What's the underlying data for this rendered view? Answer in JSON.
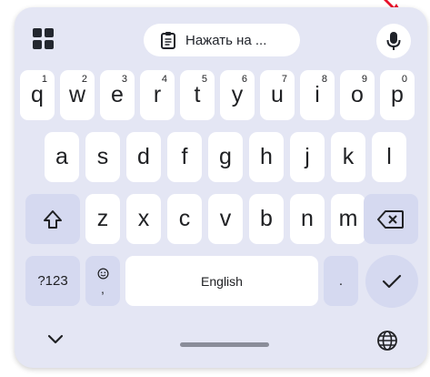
{
  "toolbar": {
    "grid_icon": "grid-apps-icon",
    "clipboard_icon": "clipboard-icon",
    "clipboard_text": "Нажать на ...",
    "mic_icon": "microphone-icon"
  },
  "rows": {
    "row1": [
      {
        "label": "q",
        "hint": "1"
      },
      {
        "label": "w",
        "hint": "2"
      },
      {
        "label": "e",
        "hint": "3"
      },
      {
        "label": "r",
        "hint": "4"
      },
      {
        "label": "t",
        "hint": "5"
      },
      {
        "label": "y",
        "hint": "6"
      },
      {
        "label": "u",
        "hint": "7"
      },
      {
        "label": "i",
        "hint": "8"
      },
      {
        "label": "o",
        "hint": "9"
      },
      {
        "label": "p",
        "hint": "0"
      }
    ],
    "row2": [
      "a",
      "s",
      "d",
      "f",
      "g",
      "h",
      "j",
      "k",
      "l"
    ],
    "row3": [
      "z",
      "x",
      "c",
      "v",
      "b",
      "n",
      "m"
    ]
  },
  "special_keys": {
    "shift_icon": "shift-icon",
    "backspace_icon": "backspace-icon",
    "symbols_label": "?123",
    "emoji_icon": "emoji-icon",
    "emoji_comma": ",",
    "space_label": "English",
    "period_label": ".",
    "enter_icon": "check-icon"
  },
  "bottom_bar": {
    "hide_icon": "chevron-down-icon",
    "globe_icon": "globe-icon"
  },
  "colors": {
    "keyboard_bg": "#e4e6f4",
    "key_bg": "#ffffff",
    "special_key_bg": "#d5d9f0",
    "arrow": "#e8102a"
  }
}
